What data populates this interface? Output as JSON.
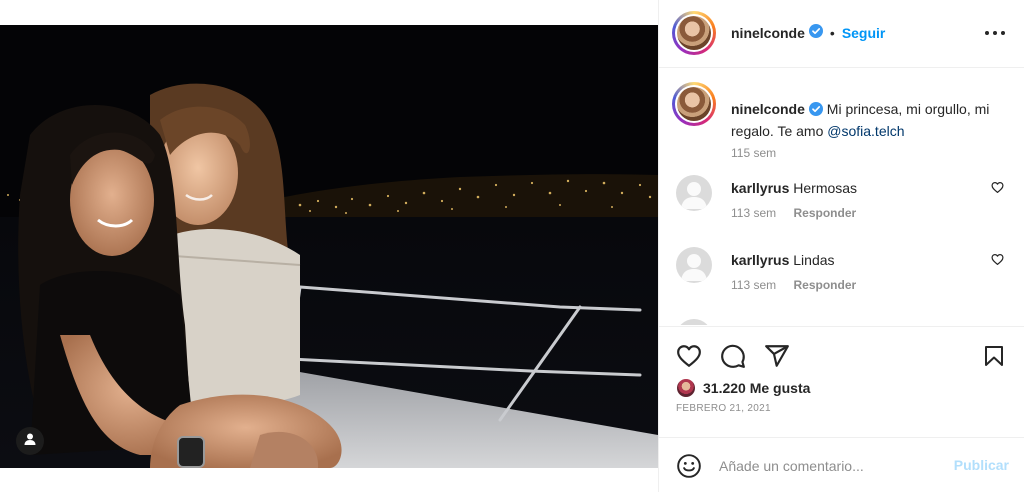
{
  "post": {
    "author": "ninelconde",
    "follow_label": "Seguir",
    "dot": "•",
    "caption_text": "Mi princesa, mi orgullo, mi regalo. Te amo ",
    "caption_mention": "@sofia.telch",
    "caption_time": "115 sem",
    "likes": "31.220 Me gusta",
    "date": "FEBRERO 21, 2021"
  },
  "comments": [
    {
      "user": "karllyrus",
      "text": "Hermosas",
      "time": "113 sem",
      "reply_label": "Responder"
    },
    {
      "user": "karllyrus",
      "text": "Lindas",
      "time": "113 sem",
      "reply_label": "Responder"
    }
  ],
  "add_comment": {
    "placeholder": "Añade un comentario...",
    "publish_label": "Publicar"
  },
  "icons": {
    "verified": "verified-badge-icon",
    "more": "more-options-icon",
    "like": "heart-icon",
    "comment": "comment-icon",
    "share": "share-icon",
    "save": "bookmark-icon",
    "emoji": "emoji-icon",
    "user_tag": "user-tag-icon"
  },
  "colors": {
    "accent": "#0095f6",
    "verified": "#3897f0",
    "publish_disabled": "#b2dffc",
    "secondary_text": "#8e8e8e",
    "mention": "#00376b"
  }
}
